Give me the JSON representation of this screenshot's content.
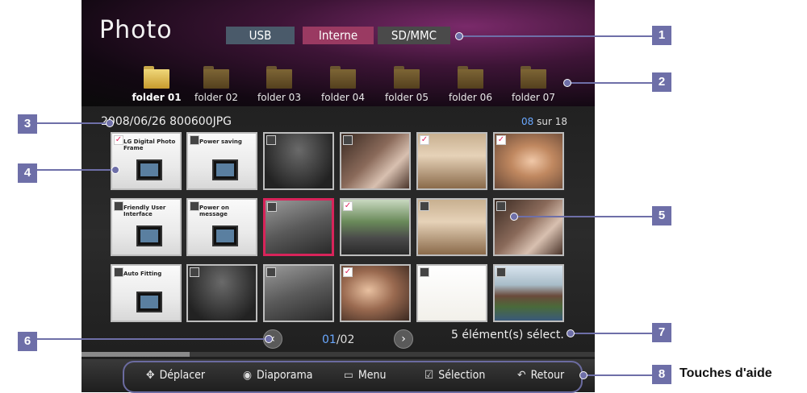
{
  "app": {
    "title": "Photo"
  },
  "sources": [
    {
      "label": "USB",
      "color": "#4a5a6a",
      "selected": false
    },
    {
      "label": "Interne",
      "color": "#9a3a62",
      "selected": true
    },
    {
      "label": "SD/MMC",
      "color": "#4a4a4a",
      "selected": false
    }
  ],
  "folders": [
    {
      "label": "folder 01",
      "selected": true
    },
    {
      "label": "folder 02",
      "selected": false
    },
    {
      "label": "folder 03",
      "selected": false
    },
    {
      "label": "folder 04",
      "selected": false
    },
    {
      "label": "folder 05",
      "selected": false
    },
    {
      "label": "folder 06",
      "selected": false
    },
    {
      "label": "folder 07",
      "selected": false
    }
  ],
  "info": {
    "filename": "2008/06/26 800600JPG",
    "current_index": "08",
    "total_text": " sur 18"
  },
  "thumbnails": [
    {
      "checked": true,
      "caption": "LG Digital Photo Frame",
      "style": "white"
    },
    {
      "checked": false,
      "caption": "Power saving",
      "style": "white"
    },
    {
      "checked": false,
      "caption": "",
      "style": "dark"
    },
    {
      "checked": false,
      "caption": "",
      "style": "sepia"
    },
    {
      "checked": true,
      "caption": "",
      "style": "room"
    },
    {
      "checked": true,
      "caption": "",
      "style": "portrait"
    },
    {
      "checked": false,
      "caption": "Friendly User Interface",
      "style": "white"
    },
    {
      "checked": false,
      "caption": "Power on message",
      "style": "white"
    },
    {
      "checked": false,
      "caption": "",
      "style": "gray"
    },
    {
      "checked": true,
      "caption": "",
      "style": "green"
    },
    {
      "checked": false,
      "caption": "",
      "style": "room"
    },
    {
      "checked": false,
      "caption": "",
      "style": "sepia"
    },
    {
      "checked": false,
      "caption": "Auto Fitting",
      "style": "white"
    },
    {
      "checked": false,
      "caption": "",
      "style": "dark"
    },
    {
      "checked": false,
      "caption": "",
      "style": "gray"
    },
    {
      "checked": true,
      "caption": "",
      "style": "couple"
    },
    {
      "checked": false,
      "caption": "",
      "style": "light"
    },
    {
      "checked": false,
      "caption": "",
      "style": "castle"
    }
  ],
  "pagination": {
    "current": "01",
    "total": "/02",
    "prev_icon": "chevron-left-icon",
    "next_icon": "chevron-right-icon"
  },
  "selection": {
    "text": "5 élément(s) sélect."
  },
  "scroll": {
    "position": 0.21
  },
  "help_keys": [
    {
      "icon": "move-arrows-icon",
      "glyph": "✥",
      "label": "Déplacer"
    },
    {
      "icon": "slideshow-icon",
      "glyph": "◉",
      "label": "Diaporama"
    },
    {
      "icon": "menu-icon",
      "glyph": "▭",
      "label": "Menu"
    },
    {
      "icon": "checkbox-icon",
      "glyph": "☑",
      "label": "Sélection"
    },
    {
      "icon": "return-icon",
      "glyph": "↶",
      "label": "Retour"
    }
  ],
  "callouts": [
    "1",
    "2",
    "3",
    "4",
    "5",
    "6",
    "7",
    "8"
  ],
  "help_caption": "Touches d'aide",
  "colors": {
    "callout": "#6e6fa8",
    "focus": "#d8245a",
    "accent": "#6aa8ff"
  }
}
